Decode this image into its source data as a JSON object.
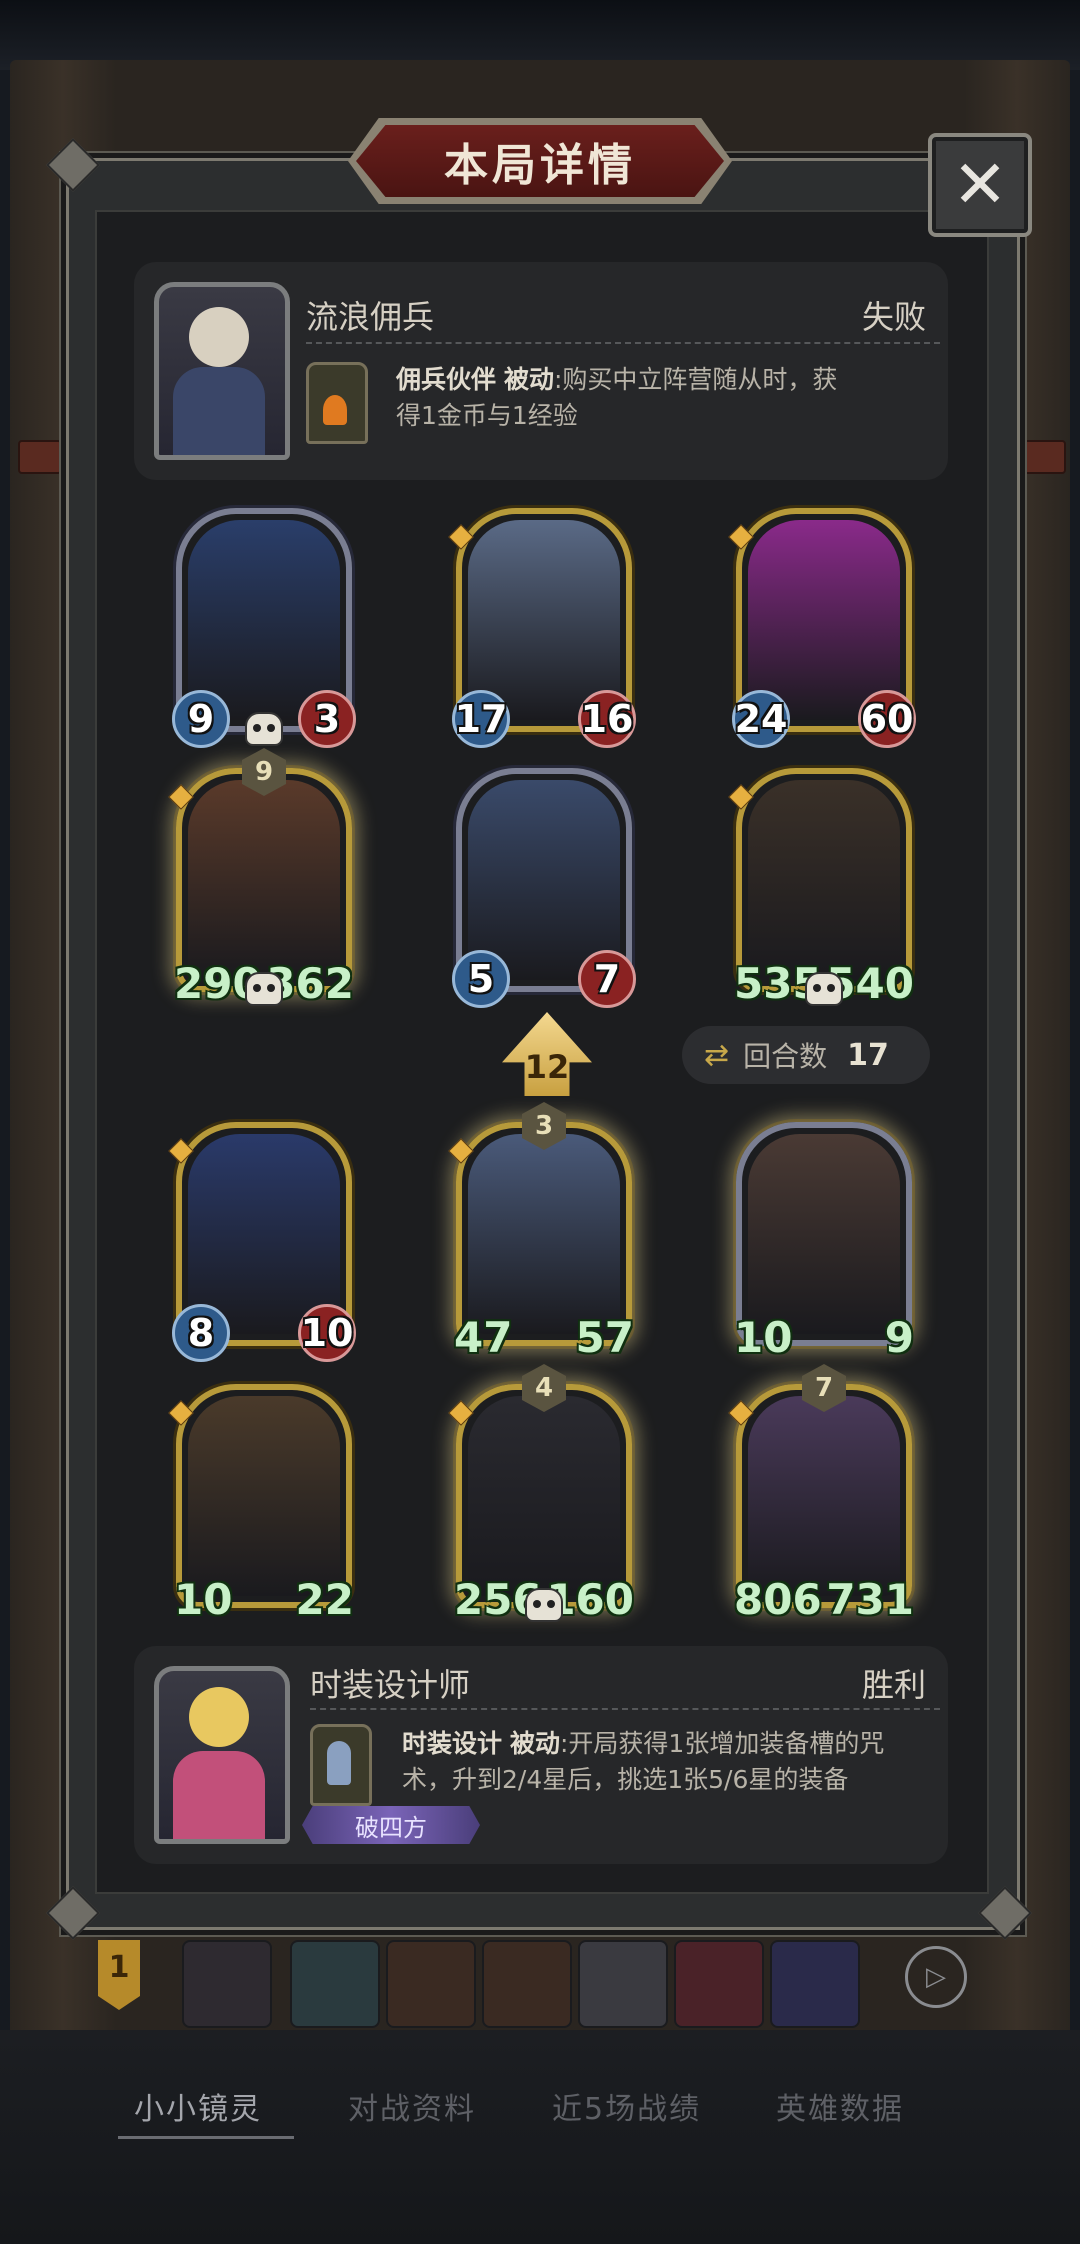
{
  "panel": {
    "title": "本局详情",
    "close": "✕"
  },
  "opponent": {
    "name": "流浪佣兵",
    "result": "失败",
    "skill_name": "佣兵伙伴",
    "skill_type": "被动",
    "skill_desc_line1": ":购买中立阵营随从时，获",
    "skill_desc_line2": "得1金币与1经验"
  },
  "opponent_units": [
    {
      "attack": "9",
      "health": "3",
      "frame": "silver",
      "orbs": true,
      "skull": true,
      "star": "",
      "color": "#2a3e6a"
    },
    {
      "attack": "17",
      "health": "16",
      "frame": "gold",
      "orbs": true,
      "skull": false,
      "star": "",
      "color": "#5a6a86"
    },
    {
      "attack": "24",
      "health": "60",
      "frame": "gold",
      "orbs": true,
      "skull": false,
      "star": "",
      "color": "#8a2a8a"
    },
    {
      "attack": "290",
      "health": "362",
      "frame": "gold",
      "orbs": false,
      "skull": true,
      "star": "9",
      "color": "#5a3a2a"
    },
    {
      "attack": "5",
      "health": "7",
      "frame": "silver",
      "orbs": true,
      "skull": false,
      "star": "",
      "color": "#3a4a6a"
    },
    {
      "attack": "535",
      "health": "540",
      "frame": "gold",
      "orbs": false,
      "skull": true,
      "star": "",
      "color": "#3a3028"
    }
  ],
  "level": "12",
  "turns": {
    "label": "回合数",
    "value": "17"
  },
  "player_units": [
    {
      "attack": "8",
      "health": "10",
      "frame": "gold",
      "orbs": true,
      "skull": false,
      "star": "",
      "color": "#2a3a6a"
    },
    {
      "attack": "47",
      "health": "57",
      "frame": "gold",
      "orbs": false,
      "skull": false,
      "star": "3",
      "color": "#4a5a7a"
    },
    {
      "attack": "10",
      "health": "9",
      "frame": "silver",
      "orbs": false,
      "skull": false,
      "star": "",
      "color": "#4a3a34"
    },
    {
      "attack": "10",
      "health": "22",
      "frame": "gold",
      "orbs": false,
      "skull": false,
      "star": "",
      "color": "#4a3a2a"
    },
    {
      "attack": "256",
      "health": "160",
      "frame": "gold",
      "orbs": false,
      "skull": true,
      "star": "4",
      "color": "#2a2a30"
    },
    {
      "attack": "806",
      "health": "731",
      "frame": "gold",
      "orbs": false,
      "skull": false,
      "star": "7",
      "color": "#4a3a5a"
    }
  ],
  "player": {
    "name": "时装设计师",
    "result": "胜利",
    "skill_name": "时装设计",
    "skill_type": "被动",
    "skill_desc_line1": ":开局获得1张增加装备槽的咒",
    "skill_desc_line2": "术，升到2/4星后，挑选1张5/6星的装备",
    "badge": "破四方"
  },
  "strip": {
    "rank": "1",
    "play_icon": "▷"
  },
  "tabs": [
    "小小镜灵",
    "对战资料",
    "近5场战绩",
    "英雄数据"
  ],
  "icons": {
    "refresh": "⇄"
  }
}
